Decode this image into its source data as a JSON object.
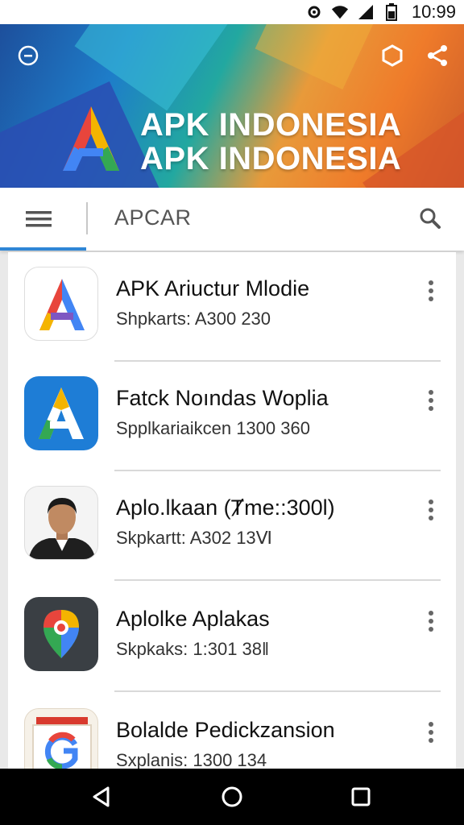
{
  "status_bar": {
    "time": "10:99"
  },
  "banner": {
    "title_line1": "APK INDONESIA",
    "title_line2": "APK INDONESIA"
  },
  "search": {
    "query": "APCAR"
  },
  "apps": [
    {
      "name": "APK Ariuctur Mlodie",
      "meta": "Shpkarts: A300 230",
      "icon": "apk-logo-colorful"
    },
    {
      "name": "Fatck Noındas Woplia",
      "meta": "Spplkariaikcen 1300 360",
      "icon": "apk-logo-blue"
    },
    {
      "name": "Aplo.lkaan (Ⱦme::300l)",
      "meta": "Skpkartt: A302 13Ⅵ",
      "icon": "person-photo"
    },
    {
      "name": "Aplolke Aplakas",
      "meta": "Skpkaks: 1:301 38‖",
      "icon": "maps-pin-logo"
    },
    {
      "name": "Bolalde Pedickzansion",
      "meta": "Sxplanis: 1300 134",
      "icon": "google-g-logo"
    }
  ],
  "colors": {
    "accent": "#2f86d6",
    "banner_blue": "#1e7dc9",
    "banner_orange": "#ef7b2a"
  }
}
